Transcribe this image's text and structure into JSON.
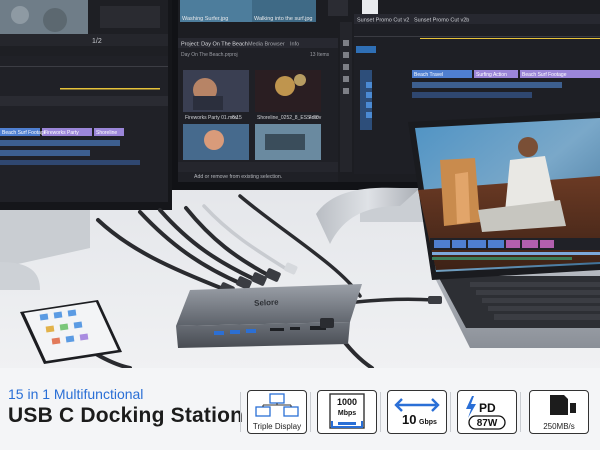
{
  "banner": {
    "headline_line1": "15 in 1 Multifunctional",
    "headline_line2": "USB C Docking Station"
  },
  "features": [
    {
      "icon": "triple-display-icon",
      "label": "Triple Display"
    },
    {
      "icon": "ethernet-icon",
      "label_top": "1000",
      "label_bottom": "Mbps"
    },
    {
      "icon": "transfer-arrows-icon",
      "label_big": "10",
      "label_small": "Gbps"
    },
    {
      "icon": "power-delivery-icon",
      "label_top": "PD",
      "label_bottom": "87W"
    },
    {
      "icon": "sd-card-icon",
      "label": "250MB/s"
    }
  ],
  "hub": {
    "brand": "Selore"
  },
  "monitor_left": {
    "timeline_tracks": [
      "Beach Surf Footage",
      "Fireworks Party",
      "Shoreline"
    ],
    "timecode": "1/2"
  },
  "monitor_right": {
    "project_title": "Project: Day On The Beach",
    "media_browser": "Media Browser",
    "info": "Info",
    "items_count": "13 Items",
    "breadcrumb": "Day On The Beach.prproj",
    "clips": [
      {
        "name": "Fireworks Party 01.mov",
        "duration": "6:15"
      },
      {
        "name": "Shoreline_0252_8_ESS.mov",
        "duration": "4:20"
      }
    ],
    "top_clips": [
      "Washing Surfer.jpg",
      "Walking into the surf.jpg"
    ],
    "sequence_tabs": [
      "Sunset Promo Cut v2",
      "Sunset Promo Cut v2b"
    ],
    "tracks": [
      "Beach Travel",
      "Surfing Action",
      "Beach Surf Footage"
    ],
    "status_text": "Add or remove from existing selection."
  },
  "colors": {
    "accent_blue": "#2a6fd6",
    "timeline_purple": "#9b86d9",
    "timeline_blue": "#4f7fd0",
    "panel_dark": "#1c1d22"
  }
}
